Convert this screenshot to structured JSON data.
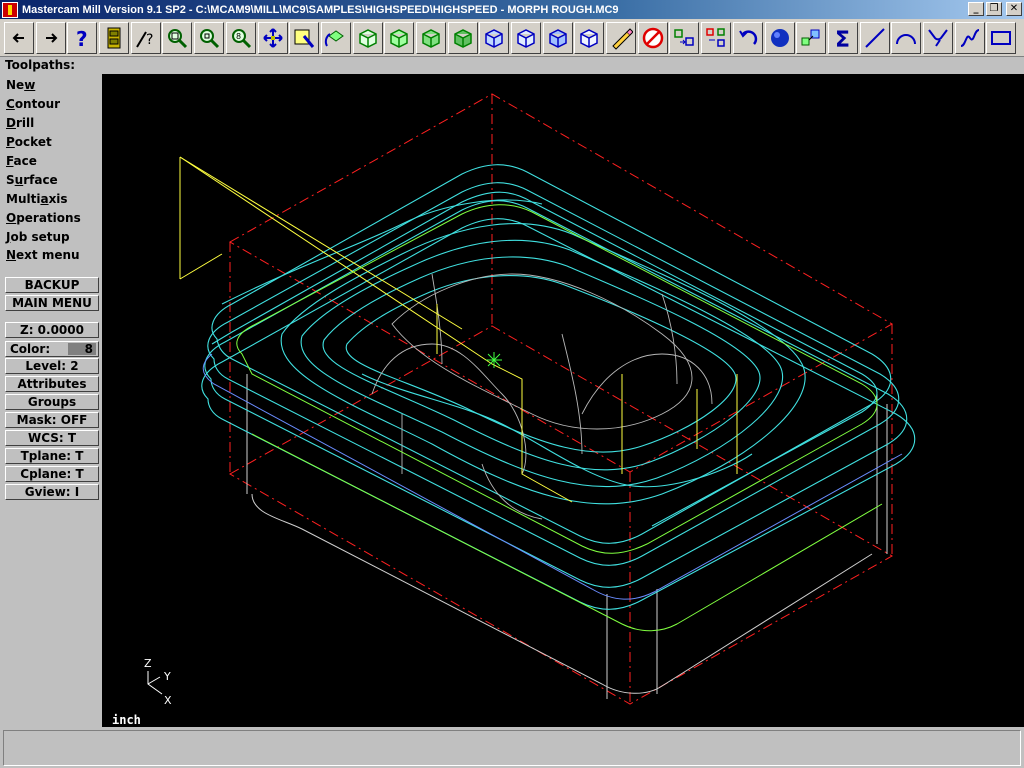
{
  "window": {
    "title": "Mastercam Mill Version 9.1 SP2 - C:\\MCAM9\\MILL\\MC9\\SAMPLES\\HIGHSPEED\\HIGHSPEED - MORPH ROUGH.MC9",
    "minimize": "_",
    "maximize": "❐",
    "close": "✕"
  },
  "toolbar": {
    "buttons": [
      "back-arrow-icon",
      "forward-arrow-icon",
      "help-icon",
      "file-cabinet-icon",
      "analyze-icon",
      "zoom-window-icon",
      "unzoom-icon",
      "zoom-target-icon",
      "pan-icon",
      "select-icon",
      "rotate-view-icon",
      "cube-green-1-icon",
      "cube-green-2-icon",
      "cube-green-3-icon",
      "cube-green-4-icon",
      "cube-blue-1-icon",
      "cube-blue-2-icon",
      "cube-blue-3-icon",
      "cube-blue-4-icon",
      "pencil-icon",
      "no-entry-icon",
      "transform-icon",
      "transform-multi-icon",
      "undo-icon",
      "sphere-icon",
      "copy-boxes-icon",
      "sigma-icon",
      "line-icon",
      "arc-icon",
      "fillet-icon",
      "spline-icon",
      "rectangle-icon"
    ]
  },
  "prompt": "Toolpaths:",
  "menu": {
    "items": [
      {
        "pre": "Ne",
        "u": "w",
        "post": ""
      },
      {
        "pre": "",
        "u": "C",
        "post": "ontour"
      },
      {
        "pre": "",
        "u": "D",
        "post": "rill"
      },
      {
        "pre": "",
        "u": "P",
        "post": "ocket"
      },
      {
        "pre": "",
        "u": "F",
        "post": "ace"
      },
      {
        "pre": "S",
        "u": "u",
        "post": "rface"
      },
      {
        "pre": "Multi",
        "u": "a",
        "post": "xis"
      },
      {
        "pre": "",
        "u": "O",
        "post": "perations"
      },
      {
        "pre": "",
        "u": "J",
        "post": "ob setup"
      },
      {
        "pre": "",
        "u": "N",
        "post": "ext menu"
      }
    ],
    "backup": "BACKUP",
    "main_menu": "MAIN MENU",
    "z": "Z:  0.0000",
    "color_label": "Color:",
    "color_value": "8",
    "level": "Level:  2",
    "attributes": "Attributes",
    "groups": "Groups",
    "mask": "Mask:  OFF",
    "wcs": "WCS:   T",
    "tplane": "Tplane:   T",
    "cplane": "Cplane:   T",
    "gview": "Gview:   I"
  },
  "viewport": {
    "units": "inch",
    "axis": {
      "z": "Z",
      "y": "Y",
      "x": "X"
    },
    "colors": {
      "toolpath": "#40e0e0",
      "stock": "#ff2020",
      "part": "#d0d0d0",
      "yellow": "#ffff40",
      "blue": "#6a8cff",
      "green": "#80ff40"
    }
  },
  "status": {
    "text": ""
  }
}
